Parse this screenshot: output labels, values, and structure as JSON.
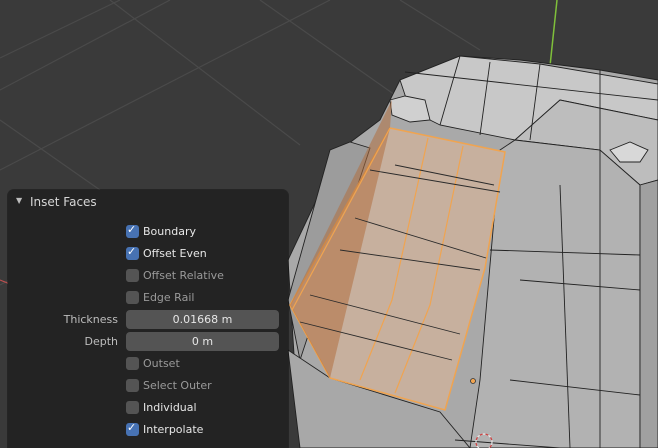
{
  "panel": {
    "title": "Inset Faces",
    "options": [
      {
        "label": "Boundary",
        "checked": true
      },
      {
        "label": "Offset Even",
        "checked": true
      },
      {
        "label": "Offset Relative",
        "checked": false
      },
      {
        "label": "Edge Rail",
        "checked": false
      }
    ],
    "thickness": {
      "label": "Thickness",
      "value": "0.01668 m"
    },
    "depth": {
      "label": "Depth",
      "value": "0 m"
    },
    "options2": [
      {
        "label": "Outset",
        "checked": false
      },
      {
        "label": "Select Outer",
        "checked": false
      },
      {
        "label": "Individual",
        "checked": false
      },
      {
        "label": "Interpolate",
        "checked": true
      }
    ]
  },
  "colors": {
    "background": "#3a3a3a",
    "grid": "#4a4a4a",
    "mesh_face": "#b5b5b5",
    "selection_edge": "#f0a450",
    "checkbox_on": "#4772b3",
    "y_axis": "#7fbf3a"
  }
}
